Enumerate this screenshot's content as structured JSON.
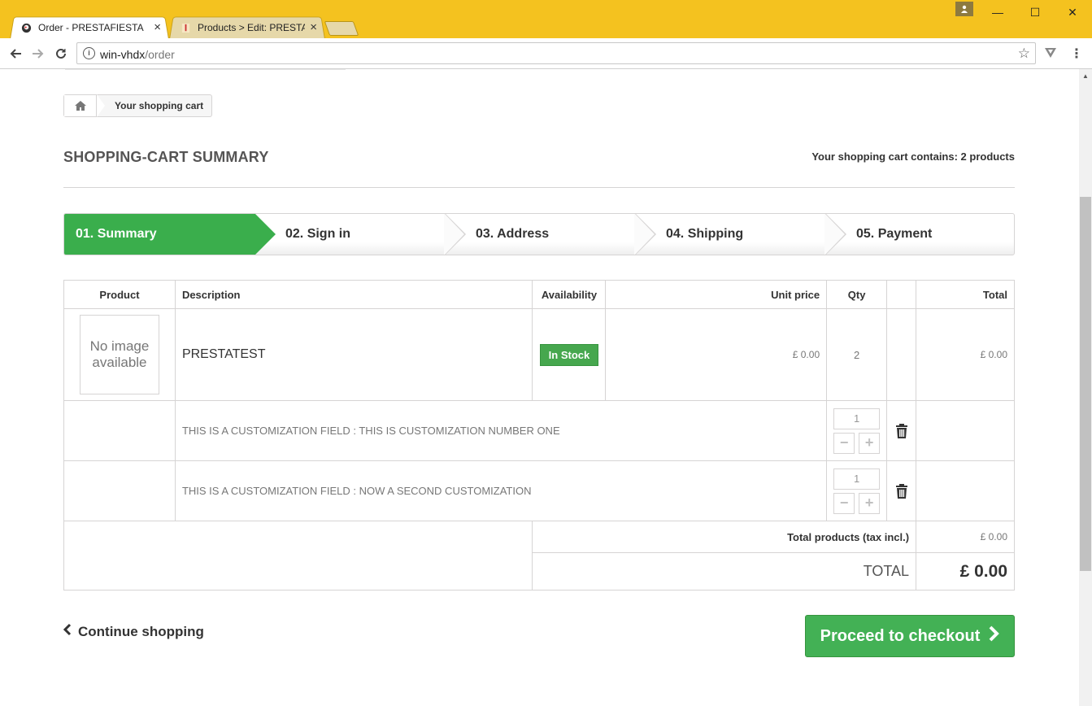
{
  "browser": {
    "tabs": [
      {
        "title": "Order - PRESTAFIESTA",
        "close": "×"
      },
      {
        "title": "Products > Edit: PRESTAT",
        "close": "×"
      }
    ],
    "url_host": "win-vhdx",
    "url_path": "/order",
    "window_controls": {
      "minimize": "—",
      "maximize": "☐",
      "close": "✕"
    }
  },
  "breadcrumb": {
    "current": "Your shopping cart"
  },
  "heading": {
    "title": "SHOPPING-CART SUMMARY",
    "counter": "Your shopping cart contains: 2 products"
  },
  "steps": [
    "01. Summary",
    "02. Sign in",
    "03. Address",
    "04. Shipping",
    "05. Payment"
  ],
  "table": {
    "headers": {
      "product": "Product",
      "description": "Description",
      "availability": "Availability",
      "unit_price": "Unit price",
      "qty": "Qty",
      "total": "Total"
    },
    "item": {
      "image_placeholder": "No image available",
      "name": "PRESTATEST",
      "availability": "In Stock",
      "unit_price": "£ 0.00",
      "qty": "2",
      "total": "£ 0.00"
    },
    "customizations": [
      {
        "text": "THIS IS A CUSTOMIZATION FIELD : THIS IS CUSTOMIZATION NUMBER ONE",
        "qty": "1"
      },
      {
        "text": "THIS IS A CUSTOMIZATION FIELD : NOW A SECOND CUSTOMIZATION",
        "qty": "1"
      }
    ],
    "total_products_label": "Total products (tax incl.)",
    "total_products_value": "£ 0.00",
    "total_label": "TOTAL",
    "total_value": "£ 0.00"
  },
  "actions": {
    "continue": "Continue shopping",
    "checkout": "Proceed to checkout"
  },
  "colors": {
    "brand_yellow": "#f4c21f",
    "step_active": "#3aae4c",
    "checkout": "#43b155"
  }
}
